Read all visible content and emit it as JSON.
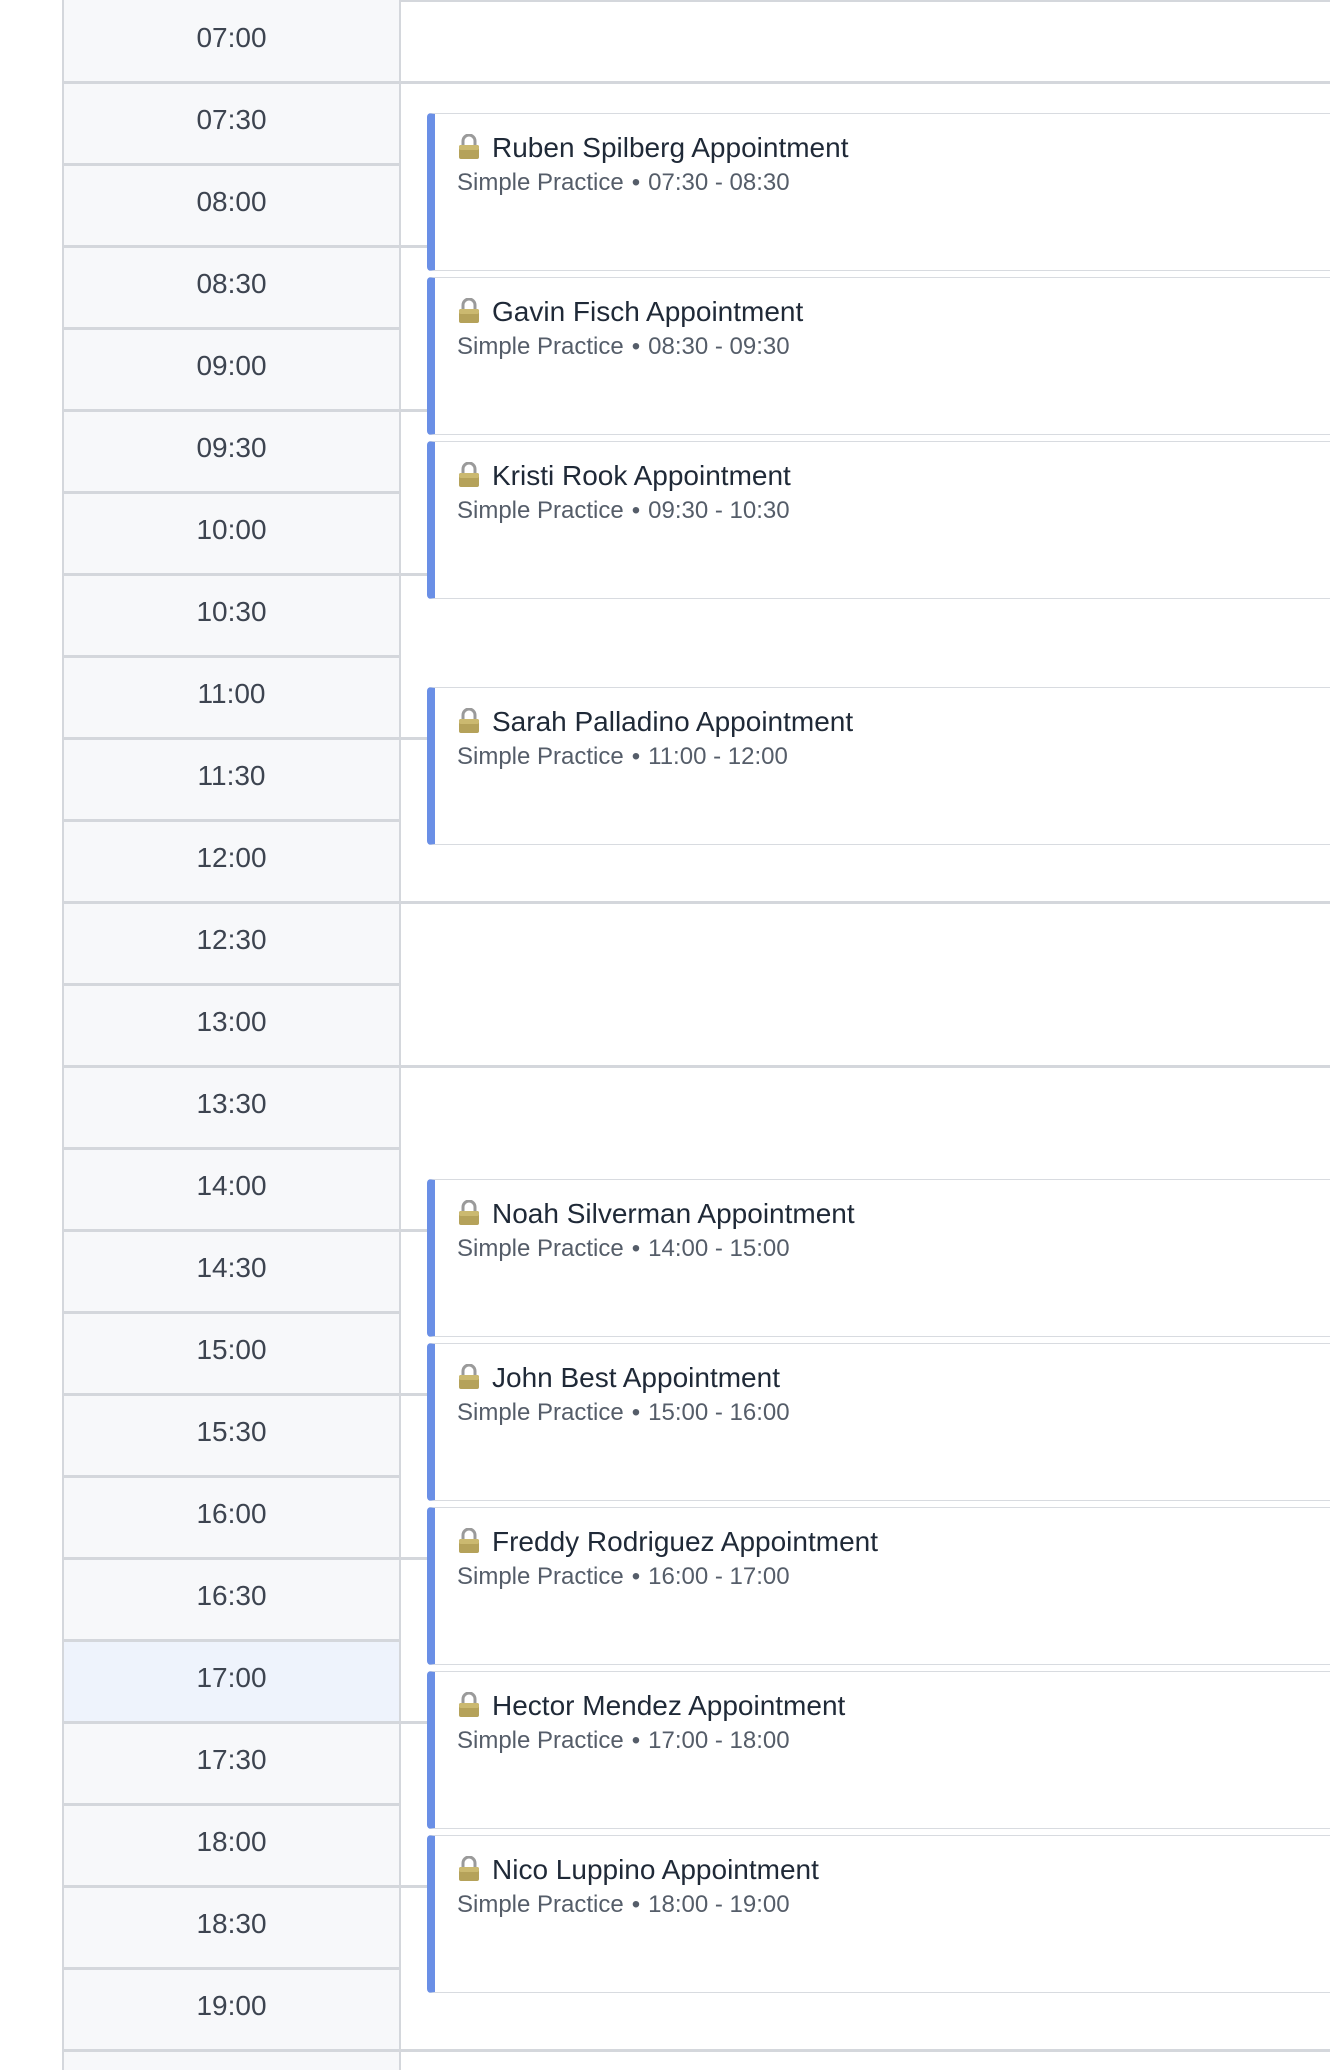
{
  "time_slots": [
    "07:00",
    "07:30",
    "08:00",
    "08:30",
    "09:00",
    "09:30",
    "10:00",
    "10:30",
    "11:00",
    "11:30",
    "12:00",
    "12:30",
    "13:00",
    "13:30",
    "14:00",
    "14:30",
    "15:00",
    "15:30",
    "16:00",
    "16:30",
    "17:00",
    "17:30",
    "18:00",
    "18:30",
    "19:00"
  ],
  "current_slot": "17:00",
  "appointments": [
    {
      "title": "Ruben Spilberg Appointment",
      "source": "Simple Practice",
      "separator": "•",
      "time": "07:30 - 08:30",
      "icon": "lock-icon"
    },
    {
      "title": "Gavin Fisch Appointment",
      "source": "Simple Practice",
      "separator": "•",
      "time": "08:30 - 09:30",
      "icon": "lock-icon"
    },
    {
      "title": "Kristi Rook Appointment",
      "source": "Simple Practice",
      "separator": "•",
      "time": "09:30 - 10:30",
      "icon": "lock-icon"
    },
    {
      "title": "Sarah Palladino Appointment",
      "source": "Simple Practice",
      "separator": "•",
      "time": "11:00 - 12:00",
      "icon": "lock-icon"
    },
    {
      "title": "Noah Silverman Appointment",
      "source": "Simple Practice",
      "separator": "•",
      "time": "14:00 - 15:00",
      "icon": "lock-icon"
    },
    {
      "title": "John Best Appointment",
      "source": "Simple Practice",
      "separator": "•",
      "time": "15:00 - 16:00",
      "icon": "lock-icon"
    },
    {
      "title": "Freddy Rodriguez Appointment",
      "source": "Simple Practice",
      "separator": "•",
      "time": "16:00 - 17:00",
      "icon": "lock-icon"
    },
    {
      "title": "Hector Mendez Appointment",
      "source": "Simple Practice",
      "separator": "•",
      "time": "17:00 - 18:00",
      "icon": "lock-icon"
    },
    {
      "title": "Nico Luppino Appointment",
      "source": "Simple Practice",
      "separator": "•",
      "time": "18:00 - 19:00",
      "icon": "lock-icon"
    }
  ],
  "colors": {
    "accent": "#6a8fe6",
    "time_column_bg": "#f7f8fa",
    "current_slot_bg": "#eef3fc",
    "grid_line": "#d4d7dc"
  }
}
